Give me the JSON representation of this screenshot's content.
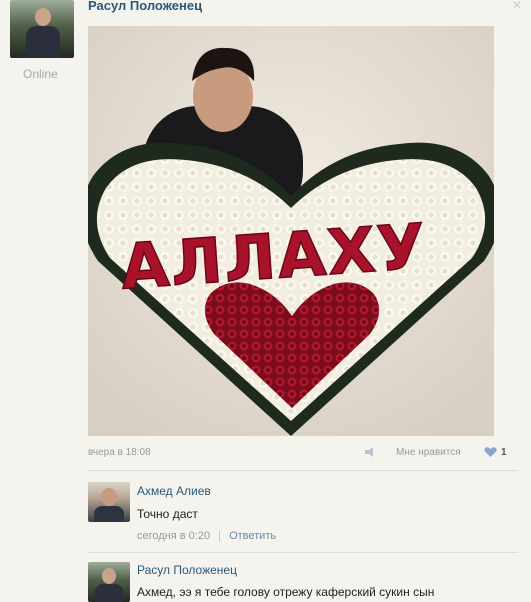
{
  "post": {
    "author": "Расул Положенец",
    "status": "Online",
    "close_symbol": "×",
    "photo_text": "АЛЛАХУ",
    "timestamp": "вчера в 18:08",
    "like_label": "Мне нравится",
    "like_count": "1"
  },
  "comments": [
    {
      "author": "Ахмед Алиев",
      "text": "Точно даст",
      "time": "сегодня в 0:20",
      "separator": "|",
      "reply_label": "Ответить"
    },
    {
      "author": "Расул Положенец",
      "text": "Ахмед, ээ я тебе голову отрежу каферский сукин сын"
    }
  ],
  "colors": {
    "link": "#2b587a",
    "like_heart": "#8aa8c8",
    "roses_red": "#a8122a",
    "roses_white": "#f3efe2"
  },
  "icons": [
    "share-icon",
    "heart-icon",
    "close-icon"
  ]
}
